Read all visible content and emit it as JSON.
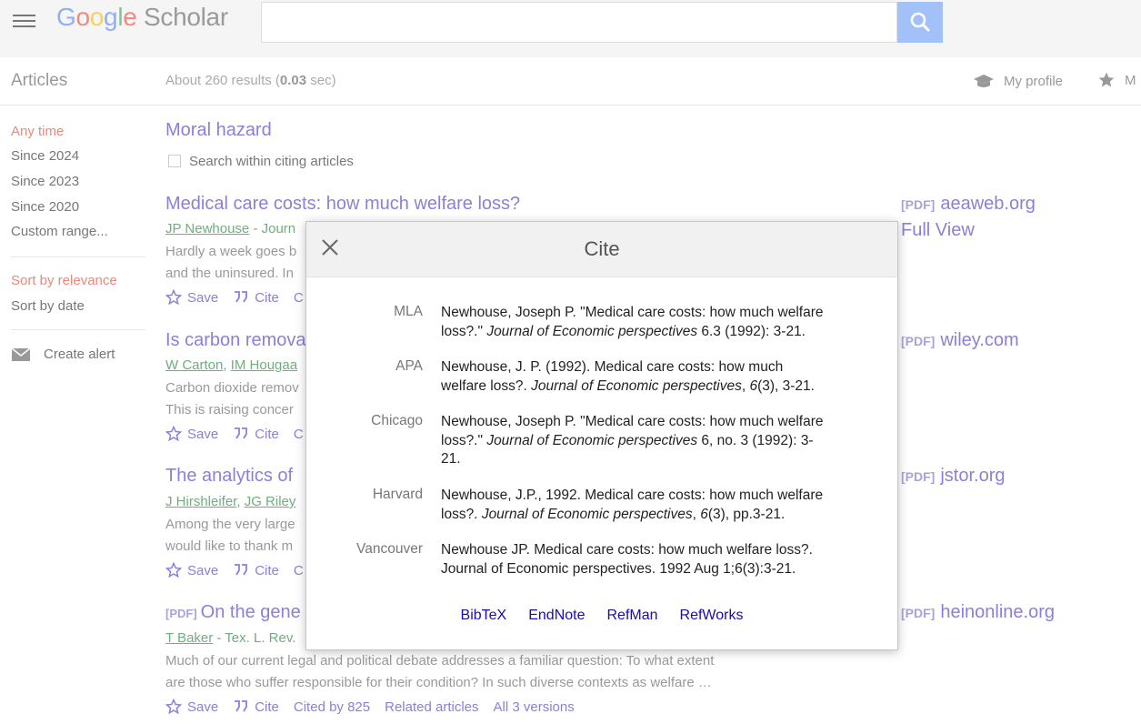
{
  "header": {
    "logo_google": "Google",
    "logo_scholar": "Scholar",
    "search_value": "",
    "search_placeholder": ""
  },
  "subbar": {
    "section": "Articles",
    "results_prefix": "About 260 results (",
    "results_time": "0.03",
    "results_suffix": " sec)",
    "my_profile": "My profile",
    "my_library": "M"
  },
  "sidebar": {
    "time_filters": [
      "Any time",
      "Since 2024",
      "Since 2023",
      "Since 2020",
      "Custom range..."
    ],
    "sort": [
      "Sort by relevance",
      "Sort by date"
    ],
    "create_alert": "Create alert"
  },
  "query": {
    "title": "Moral hazard",
    "search_within": "Search within citing articles"
  },
  "results": [
    {
      "title": "Medical care costs: how much welfare loss?",
      "authors": [
        "JP Newhouse"
      ],
      "venue": " - Journ",
      "snippet": [
        "Hardly a week goes b",
        "and the uninsured. In"
      ],
      "pdf_tag": "[PDF]",
      "pdf_source": "aeaweb.org",
      "extra_link": "Full View"
    },
    {
      "title": "Is carbon remova",
      "authors": [
        "W Carton",
        "IM Hougaa"
      ],
      "venue": "",
      "snippet": [
        "Carbon dioxide remov",
        "This is raising concer"
      ],
      "pdf_tag": "[PDF]",
      "pdf_source": "wiley.com"
    },
    {
      "title": "The analytics of",
      "authors": [
        "J Hirshleifer",
        "JG Riley"
      ],
      "venue": "",
      "snippet": [
        "Among the very large",
        "would like to thank m"
      ],
      "pdf_tag": "[PDF]",
      "pdf_source": "jstor.org"
    },
    {
      "title_tag": "[PDF]",
      "title": "On the gene",
      "authors": [
        "T Baker"
      ],
      "venue": " - Tex. L. Rev.",
      "snippet": [
        "Much of our current legal and political debate addresses a familiar question: To what extent",
        "are those who suffer responsible for their condition? In such diverse contexts as welfare …"
      ],
      "pdf_tag": "[PDF]",
      "pdf_source": "heinonline.org",
      "cited_by": "Cited by 825",
      "related": "Related articles",
      "versions": "All 3 versions"
    }
  ],
  "actions": {
    "save": "Save",
    "cite": "Cite",
    "cut": "C"
  },
  "dialog": {
    "title": "Cite",
    "citations": [
      {
        "style": "MLA",
        "lines": [
          [
            "Newhouse, Joseph P. \"Medical care costs: how much welfare"
          ],
          [
            "loss?.\" ",
            "Journal of Economic perspectives",
            " 6.3 (1992): 3-21."
          ]
        ]
      },
      {
        "style": "APA",
        "lines": [
          [
            "Newhouse, J. P. (1992). Medical care costs: how much"
          ],
          [
            "welfare loss?. ",
            "Journal of Economic perspectives",
            ", ",
            "6",
            "(3), 3-21."
          ]
        ]
      },
      {
        "style": "Chicago",
        "lines": [
          [
            "Newhouse, Joseph P. \"Medical care costs: how much welfare"
          ],
          [
            "loss?.\" ",
            "Journal of Economic perspectives",
            " 6, no. 3 (1992): 3-"
          ],
          [
            "21."
          ]
        ]
      },
      {
        "style": "Harvard",
        "lines": [
          [
            "Newhouse, J.P., 1992. Medical care costs: how much welfare"
          ],
          [
            "loss?. ",
            "Journal of Economic perspectives",
            ", ",
            "6",
            "(3), pp.3-21."
          ]
        ]
      },
      {
        "style": "Vancouver",
        "lines": [
          [
            "Newhouse JP. Medical care costs: how much welfare loss?."
          ],
          [
            "Journal of Economic perspectives. 1992 Aug 1;6(3):3-21."
          ]
        ]
      }
    ],
    "exports": [
      "BibTeX",
      "EndNote",
      "RefMan",
      "RefWorks"
    ]
  }
}
